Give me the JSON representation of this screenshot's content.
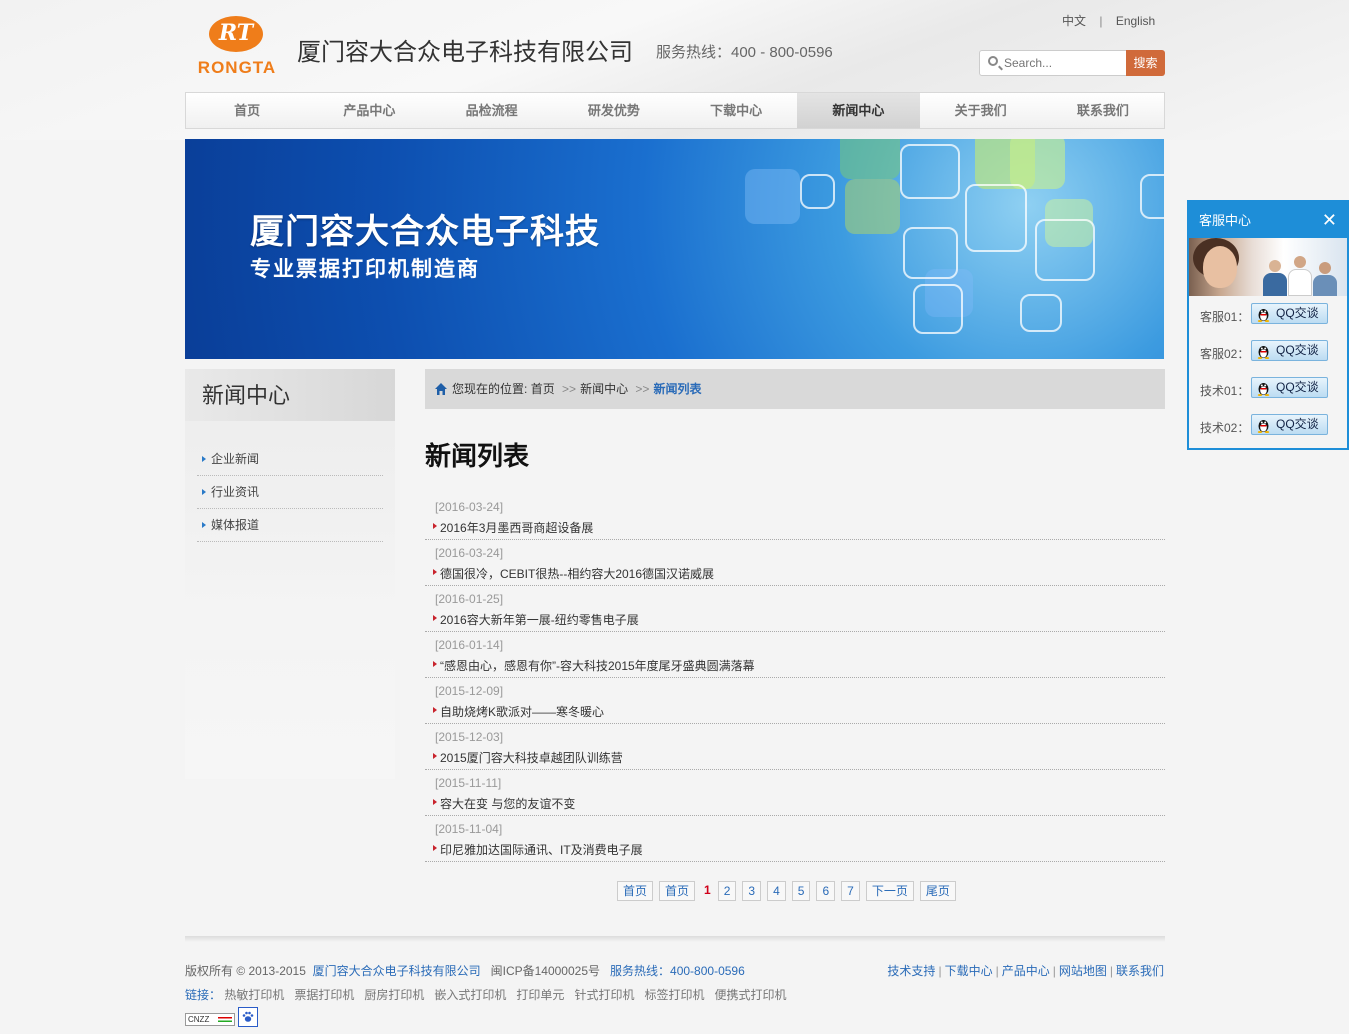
{
  "header": {
    "logo_mark": "RT",
    "logo_text": "RONGTA",
    "company_name": "厦门容大合众电子科技有限公司",
    "hotline": "服务热线：400 - 800-0596",
    "lang_cn": "中文",
    "lang_sep": "|",
    "lang_en": "English",
    "search_placeholder": "Search...",
    "search_button": "搜索"
  },
  "nav": [
    "首页",
    "产品中心",
    "品检流程",
    "研发优势",
    "下载中心",
    "新闻中心",
    "关于我们",
    "联系我们"
  ],
  "nav_active": "新闻中心",
  "banner": {
    "title": "厦门容大合众电子科技",
    "subtitle": "专业票据打印机制造商"
  },
  "sidebar": {
    "title": "新闻中心",
    "items": [
      "企业新闻",
      "行业资讯",
      "媒体报道"
    ]
  },
  "breadcrumb": {
    "prefix": "您现在的位置:",
    "home": "首页",
    "sep": ">>",
    "section": "新闻中心",
    "current": "新闻列表"
  },
  "main": {
    "title": "新闻列表",
    "news": [
      {
        "date": "[2016-03-24]",
        "title": "2016年3月墨西哥商超设备展"
      },
      {
        "date": "[2016-03-24]",
        "title": "德国很冷，CEBIT很热--相约容大2016德国汉诺威展"
      },
      {
        "date": "[2016-01-25]",
        "title": "2016容大新年第一展-纽约零售电子展"
      },
      {
        "date": "[2016-01-14]",
        "title": "“感恩由心，感恩有你”-容大科技2015年度尾牙盛典圆满落幕"
      },
      {
        "date": "[2015-12-09]",
        "title": "自助烧烤K歌派对——寒冬暖心"
      },
      {
        "date": "[2015-12-03]",
        "title": "2015厦门容大科技卓越团队训练营"
      },
      {
        "date": "[2015-11-11]",
        "title": "容大在变 与您的友谊不变"
      },
      {
        "date": "[2015-11-04]",
        "title": "印尼雅加达国际通讯、IT及消费电子展"
      }
    ]
  },
  "pager": {
    "first": "首页",
    "prev": "首页",
    "current": "1",
    "pages": [
      "2",
      "3",
      "4",
      "5",
      "6",
      "7"
    ],
    "next": "下一页",
    "last": "尾页"
  },
  "footer": {
    "copyright": "版权所有 © 2013-2015",
    "company": "厦门容大合众电子科技有限公司",
    "icp": "闽ICP备14000025号",
    "hotline": "服务热线：400-800-0596",
    "links": [
      "技术支持",
      "下载中心",
      "产品中心",
      "网站地图",
      "联系我们"
    ],
    "links_label": "链接：",
    "keywords": [
      "热敏打印机",
      "票据打印机",
      "厨房打印机",
      "嵌入式打印机",
      "打印单元",
      "针式打印机",
      "标签打印机",
      "便携式打印机"
    ],
    "badge_text": "CNZZ"
  },
  "service": {
    "title": "客服中心",
    "close": "✕",
    "rows": [
      {
        "label": "客服01：",
        "button": "QQ交谈"
      },
      {
        "label": "客服02：",
        "button": "QQ交谈"
      },
      {
        "label": "技术01：",
        "button": "QQ交谈"
      },
      {
        "label": "技术02：",
        "button": "QQ交谈"
      }
    ]
  }
}
